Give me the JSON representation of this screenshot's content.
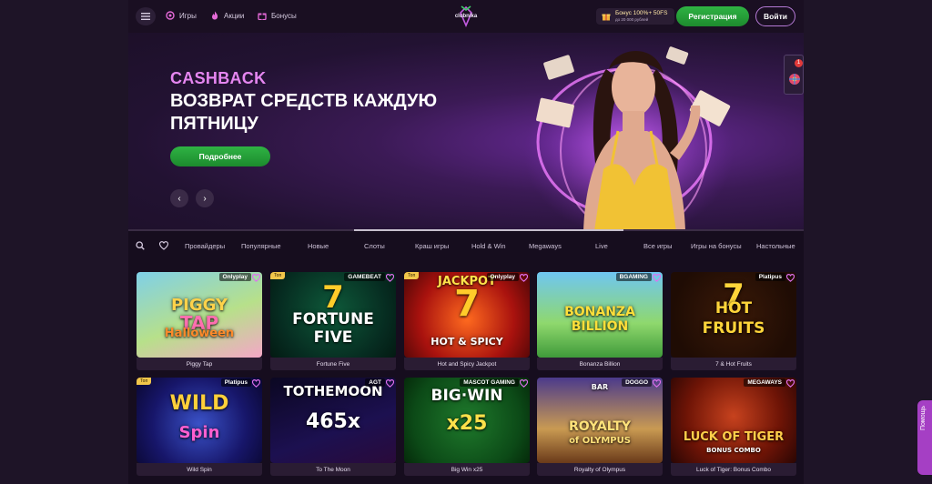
{
  "header": {
    "nav": [
      {
        "label": "Игры"
      },
      {
        "label": "Акции"
      },
      {
        "label": "Бонусы"
      }
    ],
    "logo_text": "clubnika",
    "bonus": {
      "line1": "Бонус 100%+ 50FS",
      "line2": "до 20 000 рублей"
    },
    "register_label": "Регистрация",
    "login_label": "Войти"
  },
  "hero": {
    "kicker": "CASHBACK",
    "title": "ВОЗВРАТ СРЕДСТВ КАЖДУЮ ПЯТНИЦУ",
    "button_label": "Подробнее",
    "prev_label": "‹",
    "next_label": "›",
    "slide_progress": 0.6,
    "widget_badge": "1"
  },
  "categories": [
    {
      "label": "Провайдеры"
    },
    {
      "label": "Популярные"
    },
    {
      "label": "Новые"
    },
    {
      "label": "Слоты"
    },
    {
      "label": "Краш игры"
    },
    {
      "label": "Hold & Win"
    },
    {
      "label": "Megaways"
    },
    {
      "label": "Live"
    },
    {
      "label": "Все игры"
    },
    {
      "label": "Игры на бонусы"
    },
    {
      "label": "Настольные"
    }
  ],
  "games": [
    {
      "name": "Piggy Tap",
      "provider": "Onlyplay",
      "badge": "",
      "art": [
        "PIGGY",
        "TAP",
        "Halloween"
      ]
    },
    {
      "name": "Fortune Five",
      "provider": "GAMEBEAT",
      "badge": "Топ",
      "art": [
        "7",
        "FORTUNE",
        "FIVE"
      ]
    },
    {
      "name": "Hot and Spicy Jackpot",
      "provider": "Onlyplay",
      "badge": "Топ",
      "art": [
        "JACKPOT",
        "7",
        "HOT & SPICY"
      ]
    },
    {
      "name": "Bonanza Billion",
      "provider": "BGAMING",
      "badge": "",
      "art": [
        "BONANZA",
        "BILLION",
        ""
      ]
    },
    {
      "name": "7 & Hot Fruits",
      "provider": "Platipus",
      "badge": "",
      "art": [
        "7",
        "HOT",
        "FRUITS"
      ]
    },
    {
      "name": "Wild Spin",
      "provider": "Platipus",
      "badge": "Топ",
      "art": [
        "WILD",
        "Spin",
        ""
      ]
    },
    {
      "name": "To The Moon",
      "provider": "AGT",
      "badge": "",
      "art": [
        "TOTHEMOON",
        "465x",
        ""
      ]
    },
    {
      "name": "Big Win x25",
      "provider": "MASCOT GAMING",
      "badge": "",
      "art": [
        "BIG·WIN",
        "x25",
        ""
      ]
    },
    {
      "name": "Royalty of Olympus",
      "provider": "DOGGO",
      "badge": "",
      "art": [
        "ROYALTY",
        "of OLYMPUS",
        "BAR"
      ]
    },
    {
      "name": "Luck of Tiger: Bonus Combo",
      "provider": "MEGAWAYS",
      "badge": "",
      "art": [
        "LUCK OF TIGER",
        "BONUS COMBO",
        ""
      ]
    }
  ],
  "help_label": "Помощь",
  "colors": {
    "accent_green": "#2fb344",
    "accent_purple": "#b57ad6",
    "kicker_pink": "#e586f0",
    "background": "#160d1e"
  }
}
